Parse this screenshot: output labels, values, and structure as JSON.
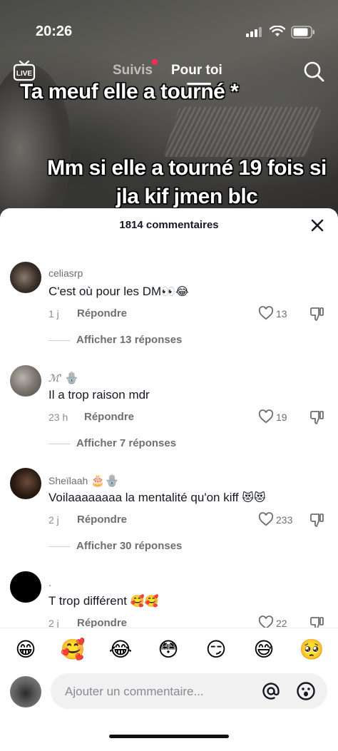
{
  "status_bar": {
    "time": "20:26"
  },
  "top_nav": {
    "live_label": "LIVE",
    "tabs": [
      {
        "label": "Suivis",
        "active": false,
        "has_dot": true
      },
      {
        "label": "Pour toi",
        "active": true
      }
    ]
  },
  "video": {
    "caption_1": "Ta meuf elle a tourné *",
    "caption_2": "Mm si elle a tourné 19 fois si jla kif jmen blc"
  },
  "comments_panel": {
    "title": "1814 commentaires",
    "reply_label": "Répondre",
    "comments": [
      {
        "username": "celiasrp",
        "text": "C'est où pour les DM",
        "emoji": "👀😂",
        "time": "1 j",
        "likes": "13",
        "replies_label": "Afficher 13 réponses"
      },
      {
        "username": "ℳ'",
        "username_emoji": "🪬",
        "text": "Il a trop raison mdr",
        "emoji": "",
        "time": "23 h",
        "likes": "19",
        "replies_label": "Afficher 7 réponses"
      },
      {
        "username": "Sheïlaah",
        "username_emoji": "🎂🪬",
        "text": "Voilaaaaaaaa la mentalité qu'on kiff",
        "emoji": "😻😻",
        "time": "2 j",
        "likes": "233",
        "replies_label": "Afficher 30 réponses"
      },
      {
        "username": ".",
        "text": "T trop différent",
        "emoji": "🥰🥰",
        "time": "2 j",
        "likes": "22",
        "replies_label": ""
      }
    ]
  },
  "emoji_bar": [
    "😁",
    "🥰",
    "😂",
    "😳",
    "😏",
    "😅",
    "🥺"
  ],
  "composer": {
    "placeholder": "Ajouter un commentaire..."
  },
  "colors": {
    "accent": "#fe2c55",
    "text": "#161823",
    "muted": "#6e6e73"
  }
}
